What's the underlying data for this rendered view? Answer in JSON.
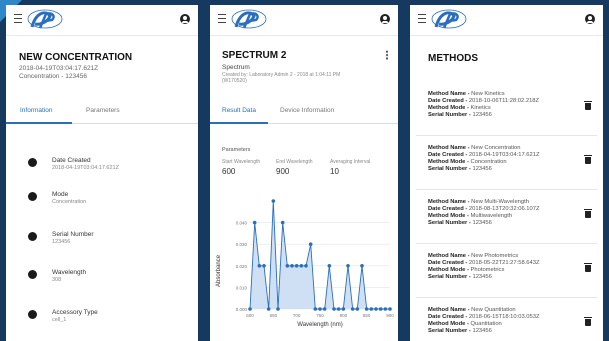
{
  "screen1": {
    "title": "NEW CONCENTRATION",
    "timestamp": "2018-04-19T03:04:17.621Z",
    "subtitle": "Concentration - 123456",
    "tabs": [
      "Information",
      "Parameters"
    ],
    "items": [
      {
        "label": "Date Created",
        "value": "2018-04-19T03:04:17.621Z",
        "icon": "info-icon"
      },
      {
        "label": "Mode",
        "value": "Concentration",
        "icon": "info-icon"
      },
      {
        "label": "Serial Number",
        "value": "123456",
        "icon": "info-icon"
      },
      {
        "label": "Wavelength",
        "value": "308",
        "icon": "info-icon"
      },
      {
        "label": "Accessory Type",
        "value": "cell_1",
        "icon": "info-icon"
      }
    ]
  },
  "screen2": {
    "title": "SPECTRUM 2",
    "subtitle": "Spectrum",
    "description": "Created by: Laboratory Admin 2 - 2018 at 1:04:11 PM (W170520)",
    "tabs": [
      "Result Data",
      "Device Information"
    ],
    "params_heading": "Parameters",
    "params": [
      {
        "label": "Start Wavelength",
        "value": "600"
      },
      {
        "label": "End Wavelength",
        "value": "900"
      },
      {
        "label": "Averaging Interval",
        "value": "10"
      }
    ]
  },
  "screen3": {
    "title": "METHODS",
    "methods": [
      {
        "name": "New Kinetics",
        "date": "2018-10-06T11:28:02.218Z",
        "mode": "Kinetics",
        "serial": "123456"
      },
      {
        "name": "New Concentration",
        "date": "2018-04-19T03:04:17.621Z",
        "mode": "Concentration",
        "serial": "123456"
      },
      {
        "name": "New Multi-Wavelength",
        "date": "2018-08-13T20:32:06.107Z",
        "mode": "Multiwavelength",
        "serial": "123456"
      },
      {
        "name": "New Photometrics",
        "date": "2018-05-22T21:27:58.643Z",
        "mode": "Photometrics",
        "serial": "123456"
      },
      {
        "name": "New Quantitation",
        "date": "2018-06-15T18:10:03.053Z",
        "mode": "Quantitation",
        "serial": "123456"
      }
    ],
    "labels": {
      "name": "Method Name - ",
      "date": "Date Created - ",
      "mode": "Method Mode - ",
      "serial": "Serial Number - "
    }
  },
  "chart_data": {
    "type": "line",
    "xlabel": "Wavelength (nm)",
    "ylabel": "Absorbance",
    "x": [
      600,
      610,
      620,
      630,
      640,
      650,
      660,
      670,
      680,
      690,
      700,
      710,
      720,
      730,
      740,
      750,
      760,
      770,
      780,
      790,
      800,
      810,
      820,
      830,
      840,
      850,
      860,
      870,
      880,
      890,
      900
    ],
    "y": [
      0.0,
      0.04,
      0.02,
      0.02,
      0.0,
      0.05,
      0.0,
      0.04,
      0.02,
      0.02,
      0.02,
      0.02,
      0.02,
      0.03,
      0.0,
      0.0,
      0.0,
      0.02,
      0.0,
      0.0,
      0.0,
      0.02,
      0.0,
      0.0,
      0.02,
      0.0,
      0.0,
      0.0,
      0.0,
      0.0,
      0.0
    ],
    "xticks": [
      "600",
      "650",
      "700",
      "750",
      "800",
      "850",
      "900"
    ],
    "yticks": [
      "0.000",
      "0.010",
      "0.020",
      "0.030",
      "0.040"
    ],
    "ylim": [
      0,
      0.05
    ],
    "xlim": [
      600,
      900
    ],
    "grid": true,
    "color": "#2a6fbd",
    "fill": "#cfe0f5"
  },
  "accent": "#2a6fbd"
}
